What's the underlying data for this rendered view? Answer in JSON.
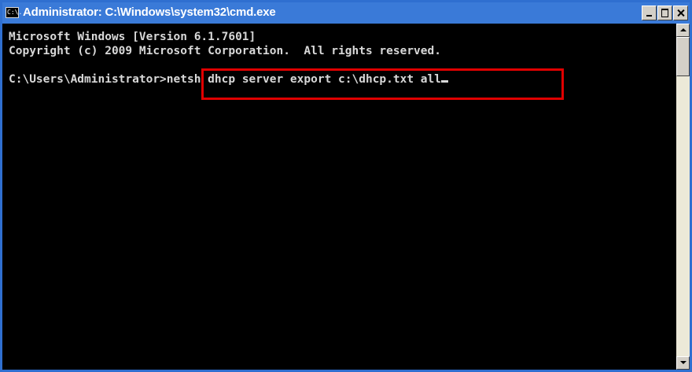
{
  "window": {
    "title": "Administrator: C:\\Windows\\system32\\cmd.exe",
    "icon_text": "C:\\."
  },
  "console": {
    "lines": [
      "Microsoft Windows [Version 6.1.7601]",
      "Copyright (c) 2009 Microsoft Corporation.  All rights reserved.",
      ""
    ],
    "prompt": "C:\\Users\\Administrator>",
    "command": "netsh dhcp server export c:\\dhcp.txt all"
  },
  "colors": {
    "console_bg": "#000000",
    "console_text": "#d8d8d8",
    "titlebar": "#3a7ad8",
    "highlight_border": "#e00000"
  },
  "icons": [
    "cmd-app-icon",
    "minimize-icon",
    "maximize-icon",
    "close-icon",
    "scroll-up-icon",
    "scroll-down-icon"
  ]
}
